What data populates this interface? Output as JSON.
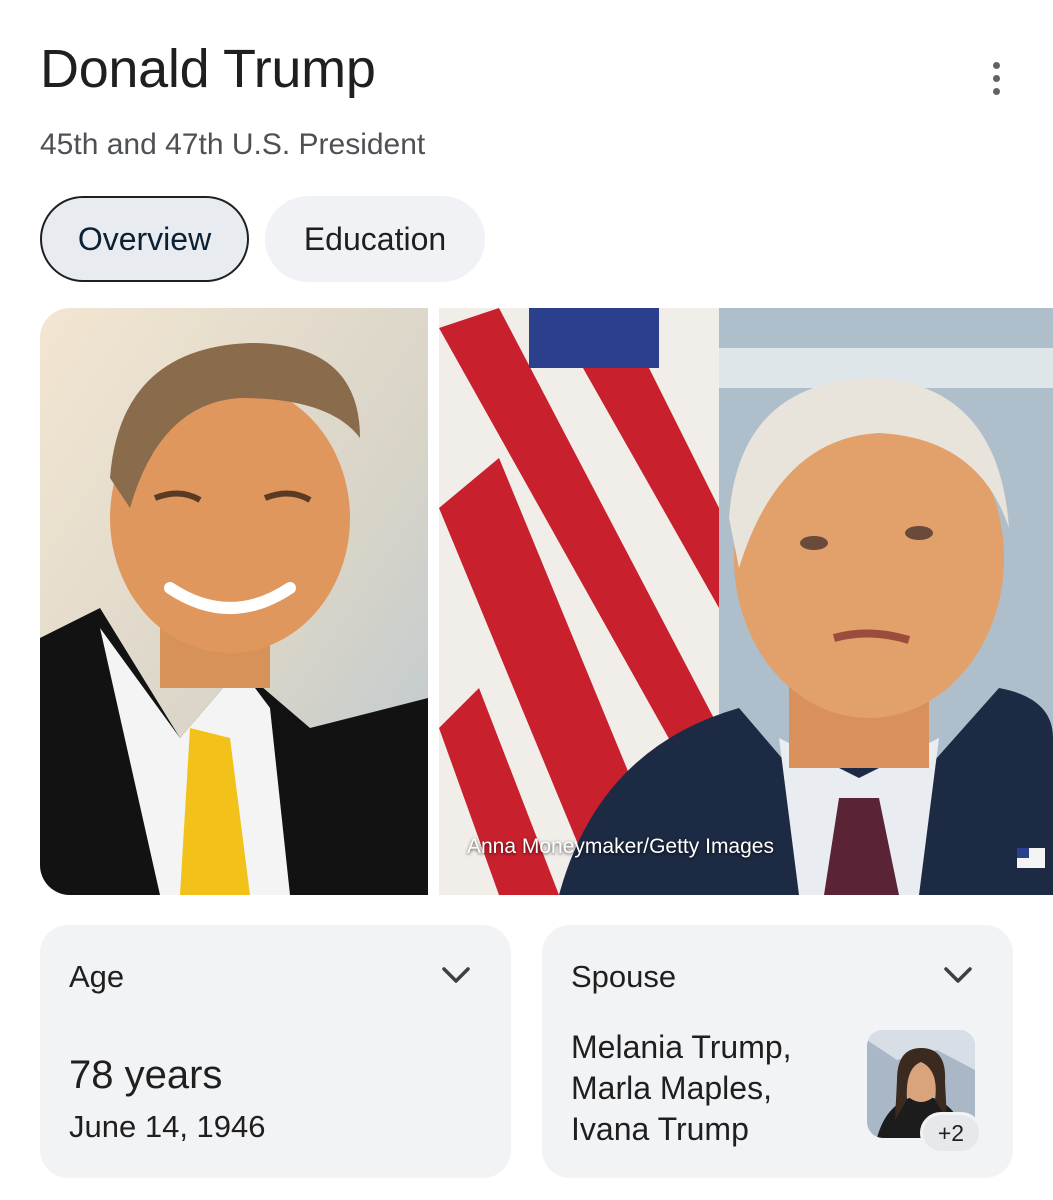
{
  "header": {
    "title": "Donald Trump",
    "subtitle": "45th and 47th U.S. President",
    "more_icon": "more-vertical-icon"
  },
  "tabs": [
    {
      "label": "Overview",
      "selected": true
    },
    {
      "label": "Education",
      "selected": false
    }
  ],
  "images": {
    "credit": "Anna Moneymaker/Getty Images"
  },
  "cards": {
    "age": {
      "label": "Age",
      "value": "78 years",
      "date": "June 14, 1946",
      "icon": "chevron-down-icon"
    },
    "spouse": {
      "label": "Spouse",
      "names": [
        "Melania Trump,",
        "Marla Maples,",
        "Ivana Trump"
      ],
      "more_badge": "+2",
      "icon": "chevron-down-icon"
    }
  },
  "colors": {
    "text_primary": "#1f1f1f",
    "text_secondary": "#4d5156",
    "card_bg": "#f2f3f5",
    "tab_selected_bg": "#e8ebef",
    "tab_bg": "#f0f2f5"
  }
}
